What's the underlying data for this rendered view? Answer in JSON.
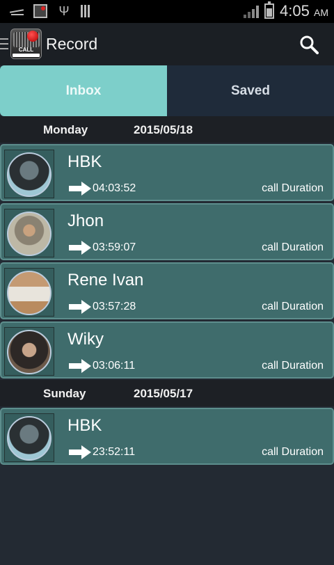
{
  "status_bar": {
    "time": "4:05",
    "ampm": "AM",
    "icons": [
      "notification-icon",
      "picture-icon",
      "usb-icon",
      "sd-card-icon",
      "signal-icon",
      "battery-icon"
    ]
  },
  "actionbar": {
    "title": "Record",
    "logo_text": "CALL"
  },
  "tabs": [
    {
      "label": "Inbox",
      "active": true
    },
    {
      "label": "Saved",
      "active": false
    }
  ],
  "groups": [
    {
      "day": "Monday",
      "date": "2015/05/18",
      "items": [
        {
          "name": "HBK",
          "duration": "04:03:52",
          "duration_label": "call Duration"
        },
        {
          "name": "Jhon",
          "duration": "03:59:07",
          "duration_label": "call Duration"
        },
        {
          "name": "Rene Ivan",
          "duration": "03:57:28",
          "duration_label": "call Duration"
        },
        {
          "name": "Wiky",
          "duration": "03:06:11",
          "duration_label": "call Duration"
        }
      ]
    },
    {
      "day": "Sunday",
      "date": "2015/05/17",
      "items": [
        {
          "name": "HBK",
          "duration": "23:52:11",
          "duration_label": "call Duration"
        }
      ]
    }
  ],
  "colors": {
    "tab_active": "#7dcfca",
    "tab_inactive": "#1f2b3a",
    "row_bg": "#3f6c6c",
    "background": "#232a33"
  }
}
